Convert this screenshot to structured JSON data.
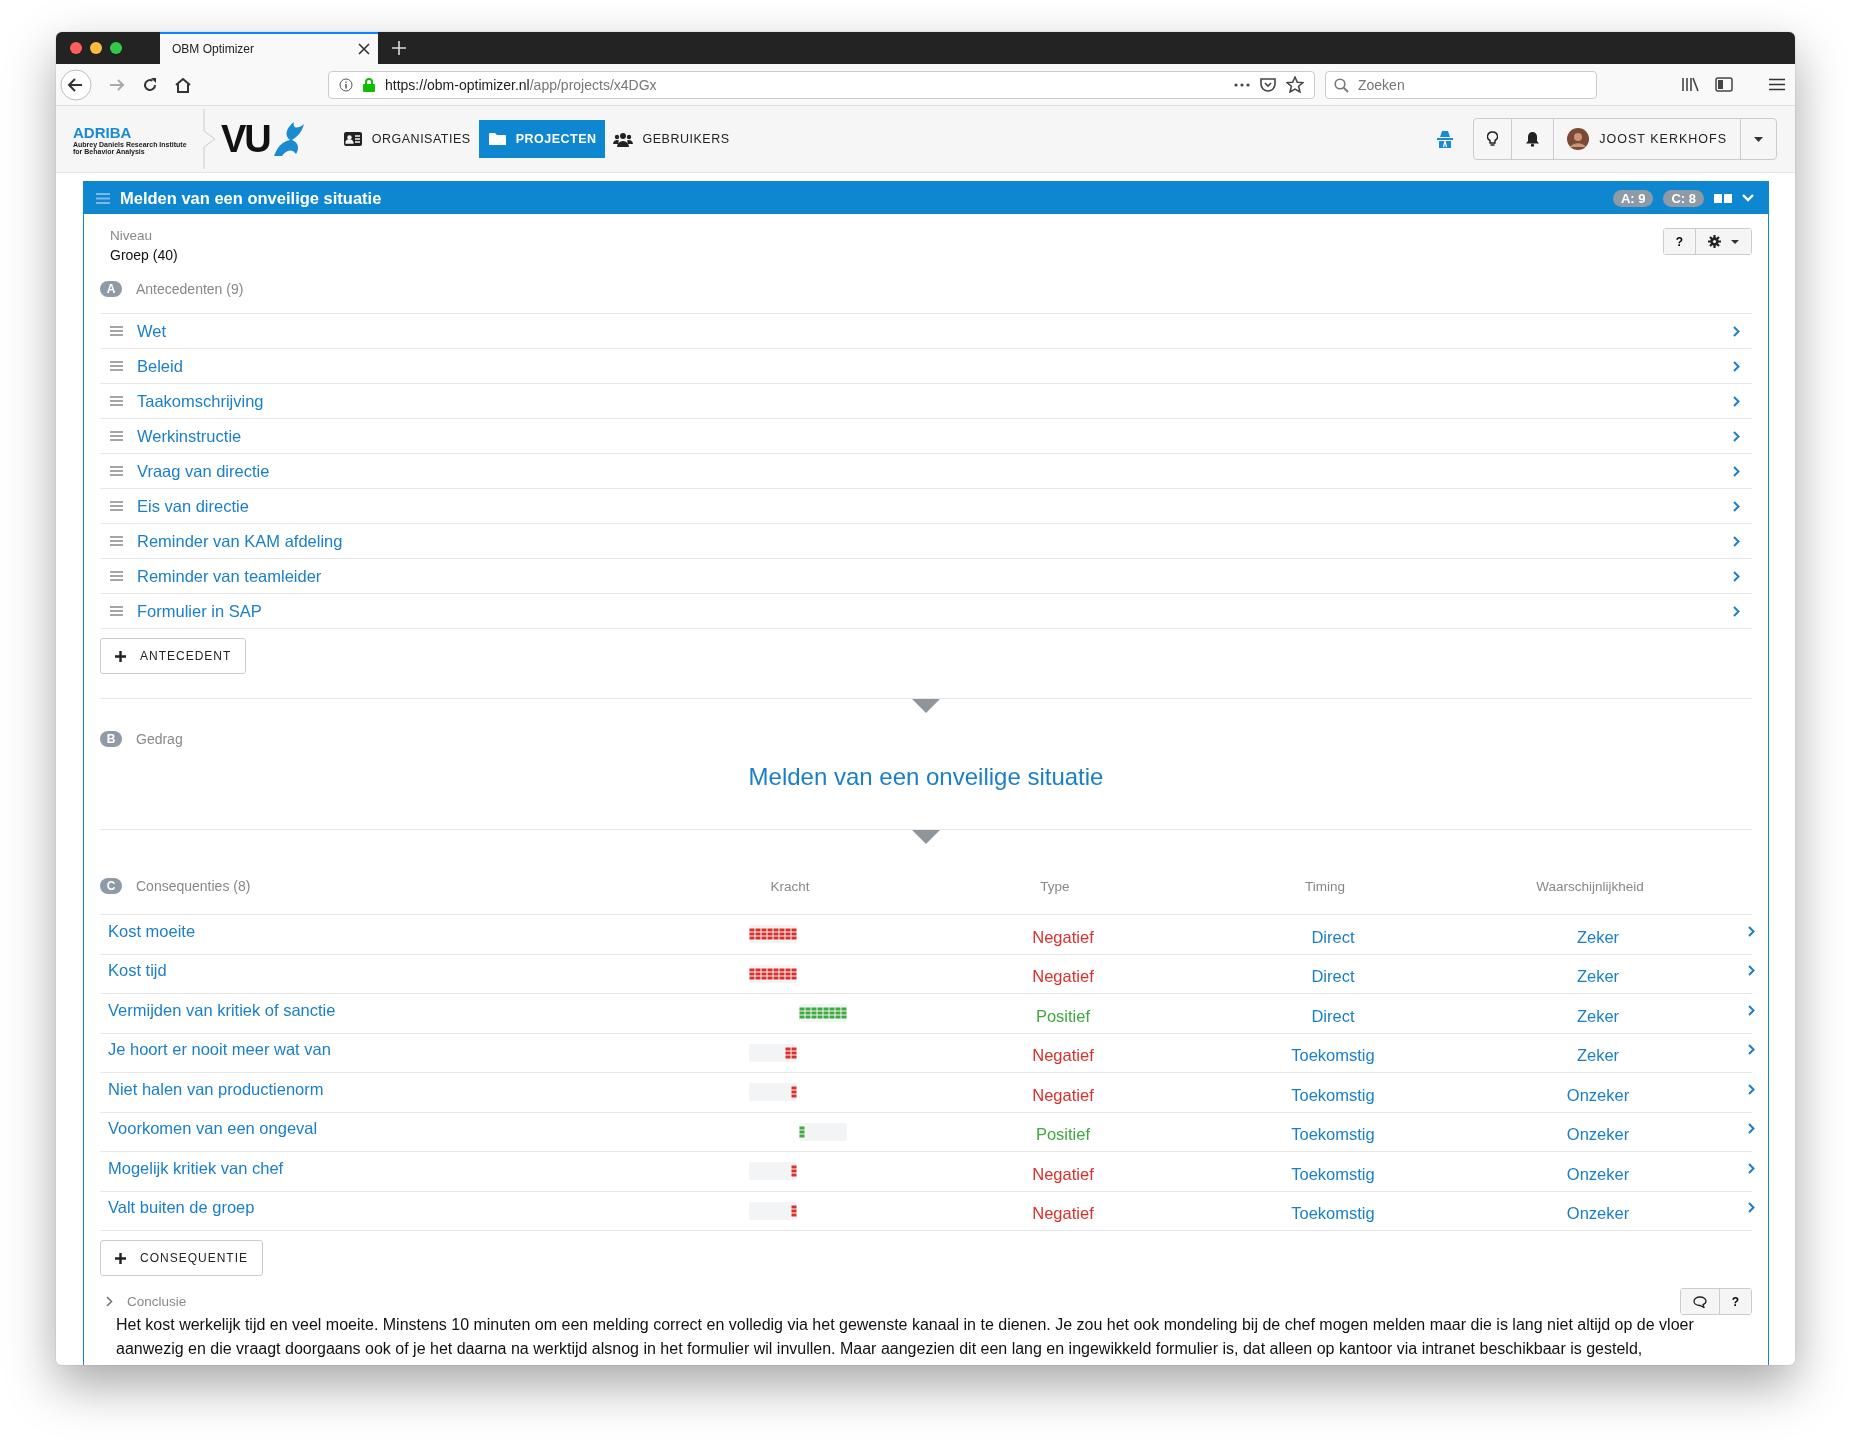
{
  "browser": {
    "tab_title": "OBM Optimizer",
    "url_host": "https://obm-optimizer.nl",
    "url_path": "/app/projects/x4DGx",
    "search_placeholder": "Zoeken"
  },
  "app_header": {
    "logo_title": "ADRIBA",
    "logo_line_1": "Aubrey Daniels Research Institute",
    "logo_line_2": "for Behavior Analysis",
    "vu_logo": "VU",
    "nav": [
      {
        "label": "ORGANISATIES",
        "kind": "card",
        "selected": false
      },
      {
        "label": "PROJECTEN",
        "kind": "folder",
        "selected": true
      },
      {
        "label": "GEBRUIKERS",
        "kind": "users",
        "selected": false
      }
    ],
    "user": "JOOST KERKHOFS"
  },
  "panel": {
    "title": "Melden van een onveilige situatie",
    "badges": [
      "A: 9",
      "C: 8"
    ],
    "niveau_label": "Niveau",
    "niveau_value": "Groep (40)",
    "help": "?",
    "antecedents": {
      "letter": "A",
      "label": "Antecedenten (9)",
      "add_button": "ANTECEDENT",
      "items": [
        "Wet",
        "Beleid",
        "Taakomschrijving",
        "Werkinstructie",
        "Vraag van directie",
        "Eis van directie",
        "Reminder van KAM afdeling",
        "Reminder van teamleider",
        "Formulier in SAP"
      ]
    },
    "behavior": {
      "letter": "B",
      "label": "Gedrag",
      "title": "Melden van een onveilige situatie"
    },
    "consequences": {
      "letter": "C",
      "label": "Consequenties (8)",
      "columns": [
        "Kracht",
        "Type",
        "Timing",
        "Waarschijnlijkheid"
      ],
      "add_button": "CONSEQUENTIE",
      "rows": [
        {
          "name": "Kost moeite",
          "kind": "negative",
          "level": 1,
          "type": "Negatief",
          "timing": "Direct",
          "probability": "Zeker"
        },
        {
          "name": "Kost tijd",
          "kind": "negative",
          "level": 1,
          "type": "Negatief",
          "timing": "Direct",
          "probability": "Zeker"
        },
        {
          "name": "Vermijden van kritiek of sanctie",
          "kind": "positive",
          "level": 1,
          "type": "Positief",
          "timing": "Direct",
          "probability": "Zeker"
        },
        {
          "name": "Je hoort er nooit meer wat van",
          "kind": "negative",
          "level": 0.25,
          "type": "Negatief",
          "timing": "Toekomstig",
          "probability": "Zeker"
        },
        {
          "name": "Niet halen van productienorm",
          "kind": "negative",
          "level": 0.125,
          "type": "Negatief",
          "timing": "Toekomstig",
          "probability": "Onzeker"
        },
        {
          "name": "Voorkomen van een ongeval",
          "kind": "positive",
          "level": 0.125,
          "type": "Positief",
          "timing": "Toekomstig",
          "probability": "Onzeker"
        },
        {
          "name": "Mogelijk kritiek van chef",
          "kind": "negative",
          "level": 0.125,
          "type": "Negatief",
          "timing": "Toekomstig",
          "probability": "Onzeker"
        },
        {
          "name": "Valt buiten de groep",
          "kind": "negative",
          "level": 0.125,
          "type": "Negatief",
          "timing": "Toekomstig",
          "probability": "Onzeker"
        }
      ]
    },
    "conclusion": {
      "label": "Conclusie",
      "help": "?",
      "text": "Het kost werkelijk tijd en veel moeite. Minstens 10 minuten om een melding correct en volledig via het gewenste kanaal in te dienen. Je zou het ook mondeling bij de chef mogen melden maar die is lang niet altijd op de vloer aanwezig en die vraagt doorgaans ook of je het daarna na werktijd alsnog in het formulier wil invullen. Maar aangezien dit een lang en ingewikkeld formulier is, dat alleen op kantoor via intranet beschikbaar is gesteld,"
    }
  }
}
